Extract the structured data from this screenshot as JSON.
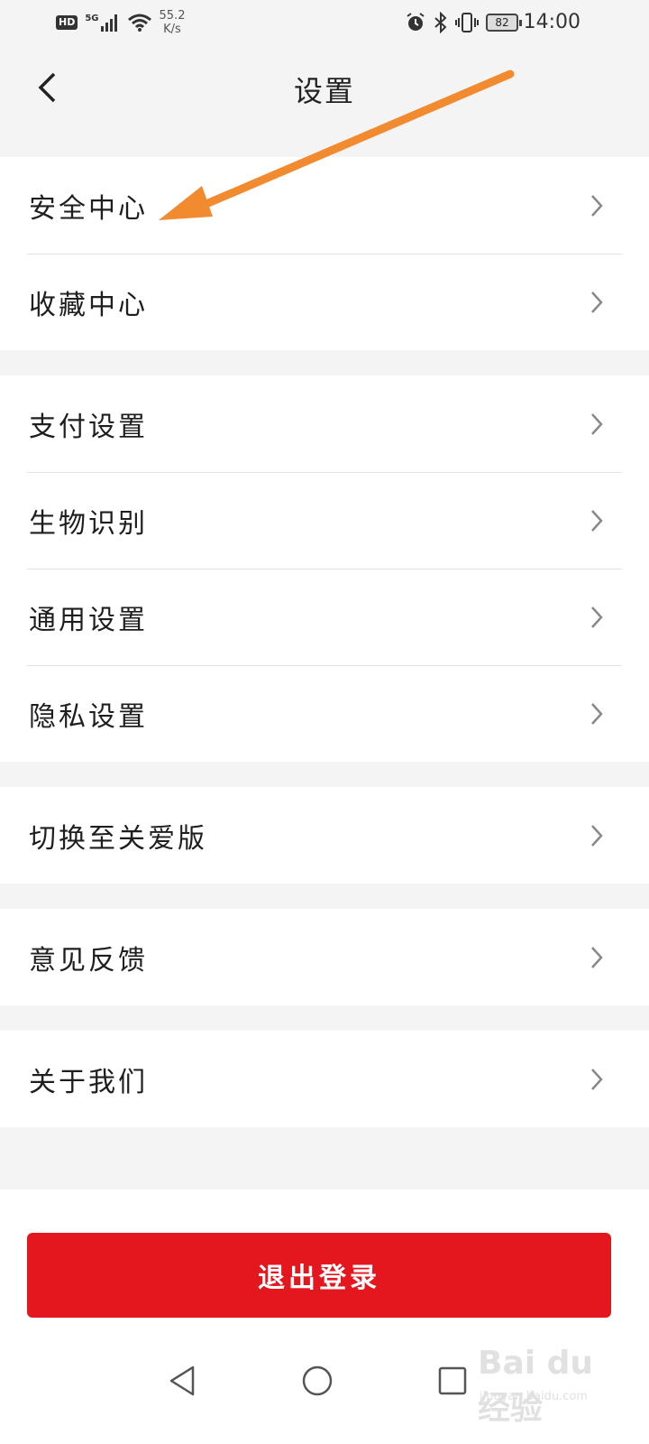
{
  "status_bar": {
    "hd": "HD",
    "network": "5G",
    "speed_value": "55.2",
    "speed_unit": "K/s",
    "battery": "82",
    "time": "14:00"
  },
  "header": {
    "title": "设置",
    "back_icon": "chevron-left-icon"
  },
  "groups": [
    {
      "items": [
        "安全中心",
        "收藏中心"
      ]
    },
    {
      "items": [
        "支付设置",
        "生物识别",
        "通用设置",
        "隐私设置"
      ]
    },
    {
      "items": [
        "切换至关爱版"
      ]
    },
    {
      "items": [
        "意见反馈"
      ]
    },
    {
      "items": [
        "关于我们"
      ]
    }
  ],
  "logout_label": "退出登录",
  "annotation": {
    "icon": "orange-arrow-icon",
    "color": "#f28a30",
    "points_to": "安全中心"
  },
  "nav": {
    "back": "triangle-back-icon",
    "home": "circle-home-icon",
    "recent": "square-recent-icon"
  },
  "watermark": {
    "brand": "Bai du 经验",
    "sub": "jingyan.baidu.com"
  },
  "colors": {
    "accent": "#e4161e",
    "background": "#f4f4f4",
    "surface": "#ffffff"
  }
}
